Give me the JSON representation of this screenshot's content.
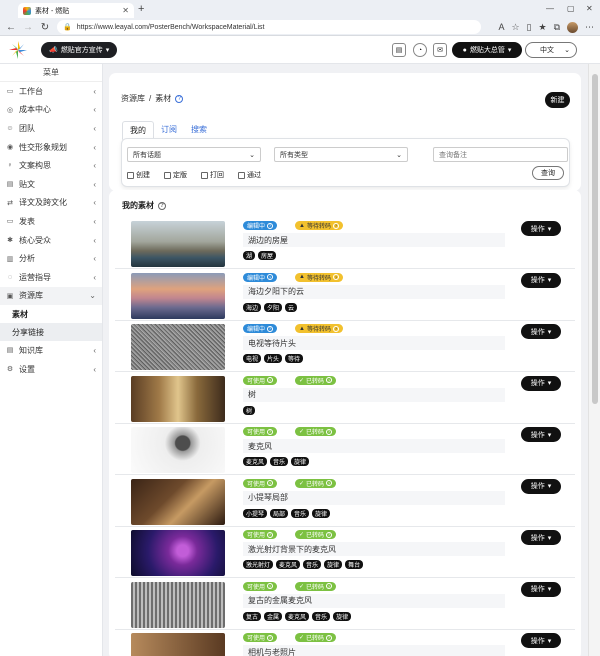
{
  "browser": {
    "tab_title": "素材 - 燃贴",
    "url": "https://www.leayal.com/PosterBench/WorkspaceMaterial/List"
  },
  "header": {
    "brand_button": "燃贴官方宣传",
    "user_button": "燃贴大总管",
    "language": "中文"
  },
  "sidebar": {
    "title": "菜单",
    "items": [
      {
        "label": "工作台",
        "icon": "monitor-icon"
      },
      {
        "label": "成本中心",
        "icon": "coins-icon"
      },
      {
        "label": "团队",
        "icon": "team-icon"
      },
      {
        "label": "性交形象规划",
        "icon": "target-icon"
      },
      {
        "label": "文案构思",
        "icon": "bulb-icon"
      },
      {
        "label": "贴文",
        "icon": "document-icon"
      },
      {
        "label": "译文及跨文化",
        "icon": "translate-icon"
      },
      {
        "label": "发表",
        "icon": "send-icon"
      },
      {
        "label": "核心受众",
        "icon": "audience-icon"
      },
      {
        "label": "分析",
        "icon": "chart-icon"
      },
      {
        "label": "运营指导",
        "icon": "guide-icon"
      },
      {
        "label": "资源库",
        "icon": "folder-icon"
      }
    ],
    "sub_items": [
      {
        "label": "素材"
      },
      {
        "label": "分享链接"
      }
    ],
    "items_after": [
      {
        "label": "知识库",
        "icon": "book-icon"
      },
      {
        "label": "设置",
        "icon": "gear-icon"
      }
    ]
  },
  "page": {
    "breadcrumb_root": "资源库",
    "breadcrumb_current": "素材",
    "new_button": "新建",
    "tabs": [
      "我的",
      "订阅",
      "搜索"
    ],
    "filter": {
      "topic_select": "所有话题",
      "type_select": "所有类型",
      "note_placeholder": "查询备注",
      "checkboxes": [
        "创建",
        "定版",
        "打回",
        "通过"
      ],
      "query_button": "查询"
    },
    "section_title": "我的素材",
    "op_label": "操作",
    "rows": [
      {
        "status": "编辑中",
        "code": "等待转码",
        "name": "湖边的房屋",
        "tags": [
          "湖",
          "房屋"
        ]
      },
      {
        "status": "编辑中",
        "code": "等待转码",
        "name": "海边夕阳下的云",
        "tags": [
          "海边",
          "夕阳",
          "云"
        ]
      },
      {
        "status": "编辑中",
        "code": "等待转码",
        "name": "电视等待片头",
        "tags": [
          "电视",
          "片头",
          "等待"
        ]
      },
      {
        "status": "可使用",
        "code": "已转码",
        "name": "树",
        "tags": [
          "树"
        ]
      },
      {
        "status": "可使用",
        "code": "已转码",
        "name": "麦克风",
        "tags": [
          "麦克风",
          "音乐",
          "旋律"
        ]
      },
      {
        "status": "可使用",
        "code": "已转码",
        "name": "小提琴局部",
        "tags": [
          "小提琴",
          "局部",
          "音乐",
          "旋律"
        ]
      },
      {
        "status": "可使用",
        "code": "已转码",
        "name": "激光射灯背景下的麦克风",
        "tags": [
          "激光射灯",
          "麦克风",
          "音乐",
          "旋律",
          "舞台"
        ]
      },
      {
        "status": "可使用",
        "code": "已转码",
        "name": "复古的金属麦克风",
        "tags": [
          "复古",
          "金属",
          "麦克风",
          "音乐",
          "旋律"
        ]
      },
      {
        "status": "可使用",
        "code": "已转码",
        "name": "相机与老照片",
        "tags": []
      }
    ]
  },
  "colors": {
    "status_editing": "#2e8bd9",
    "status_usable": "#7cc142",
    "code_waiting": "#f2c12e",
    "accent_link": "#3a6fd8"
  }
}
